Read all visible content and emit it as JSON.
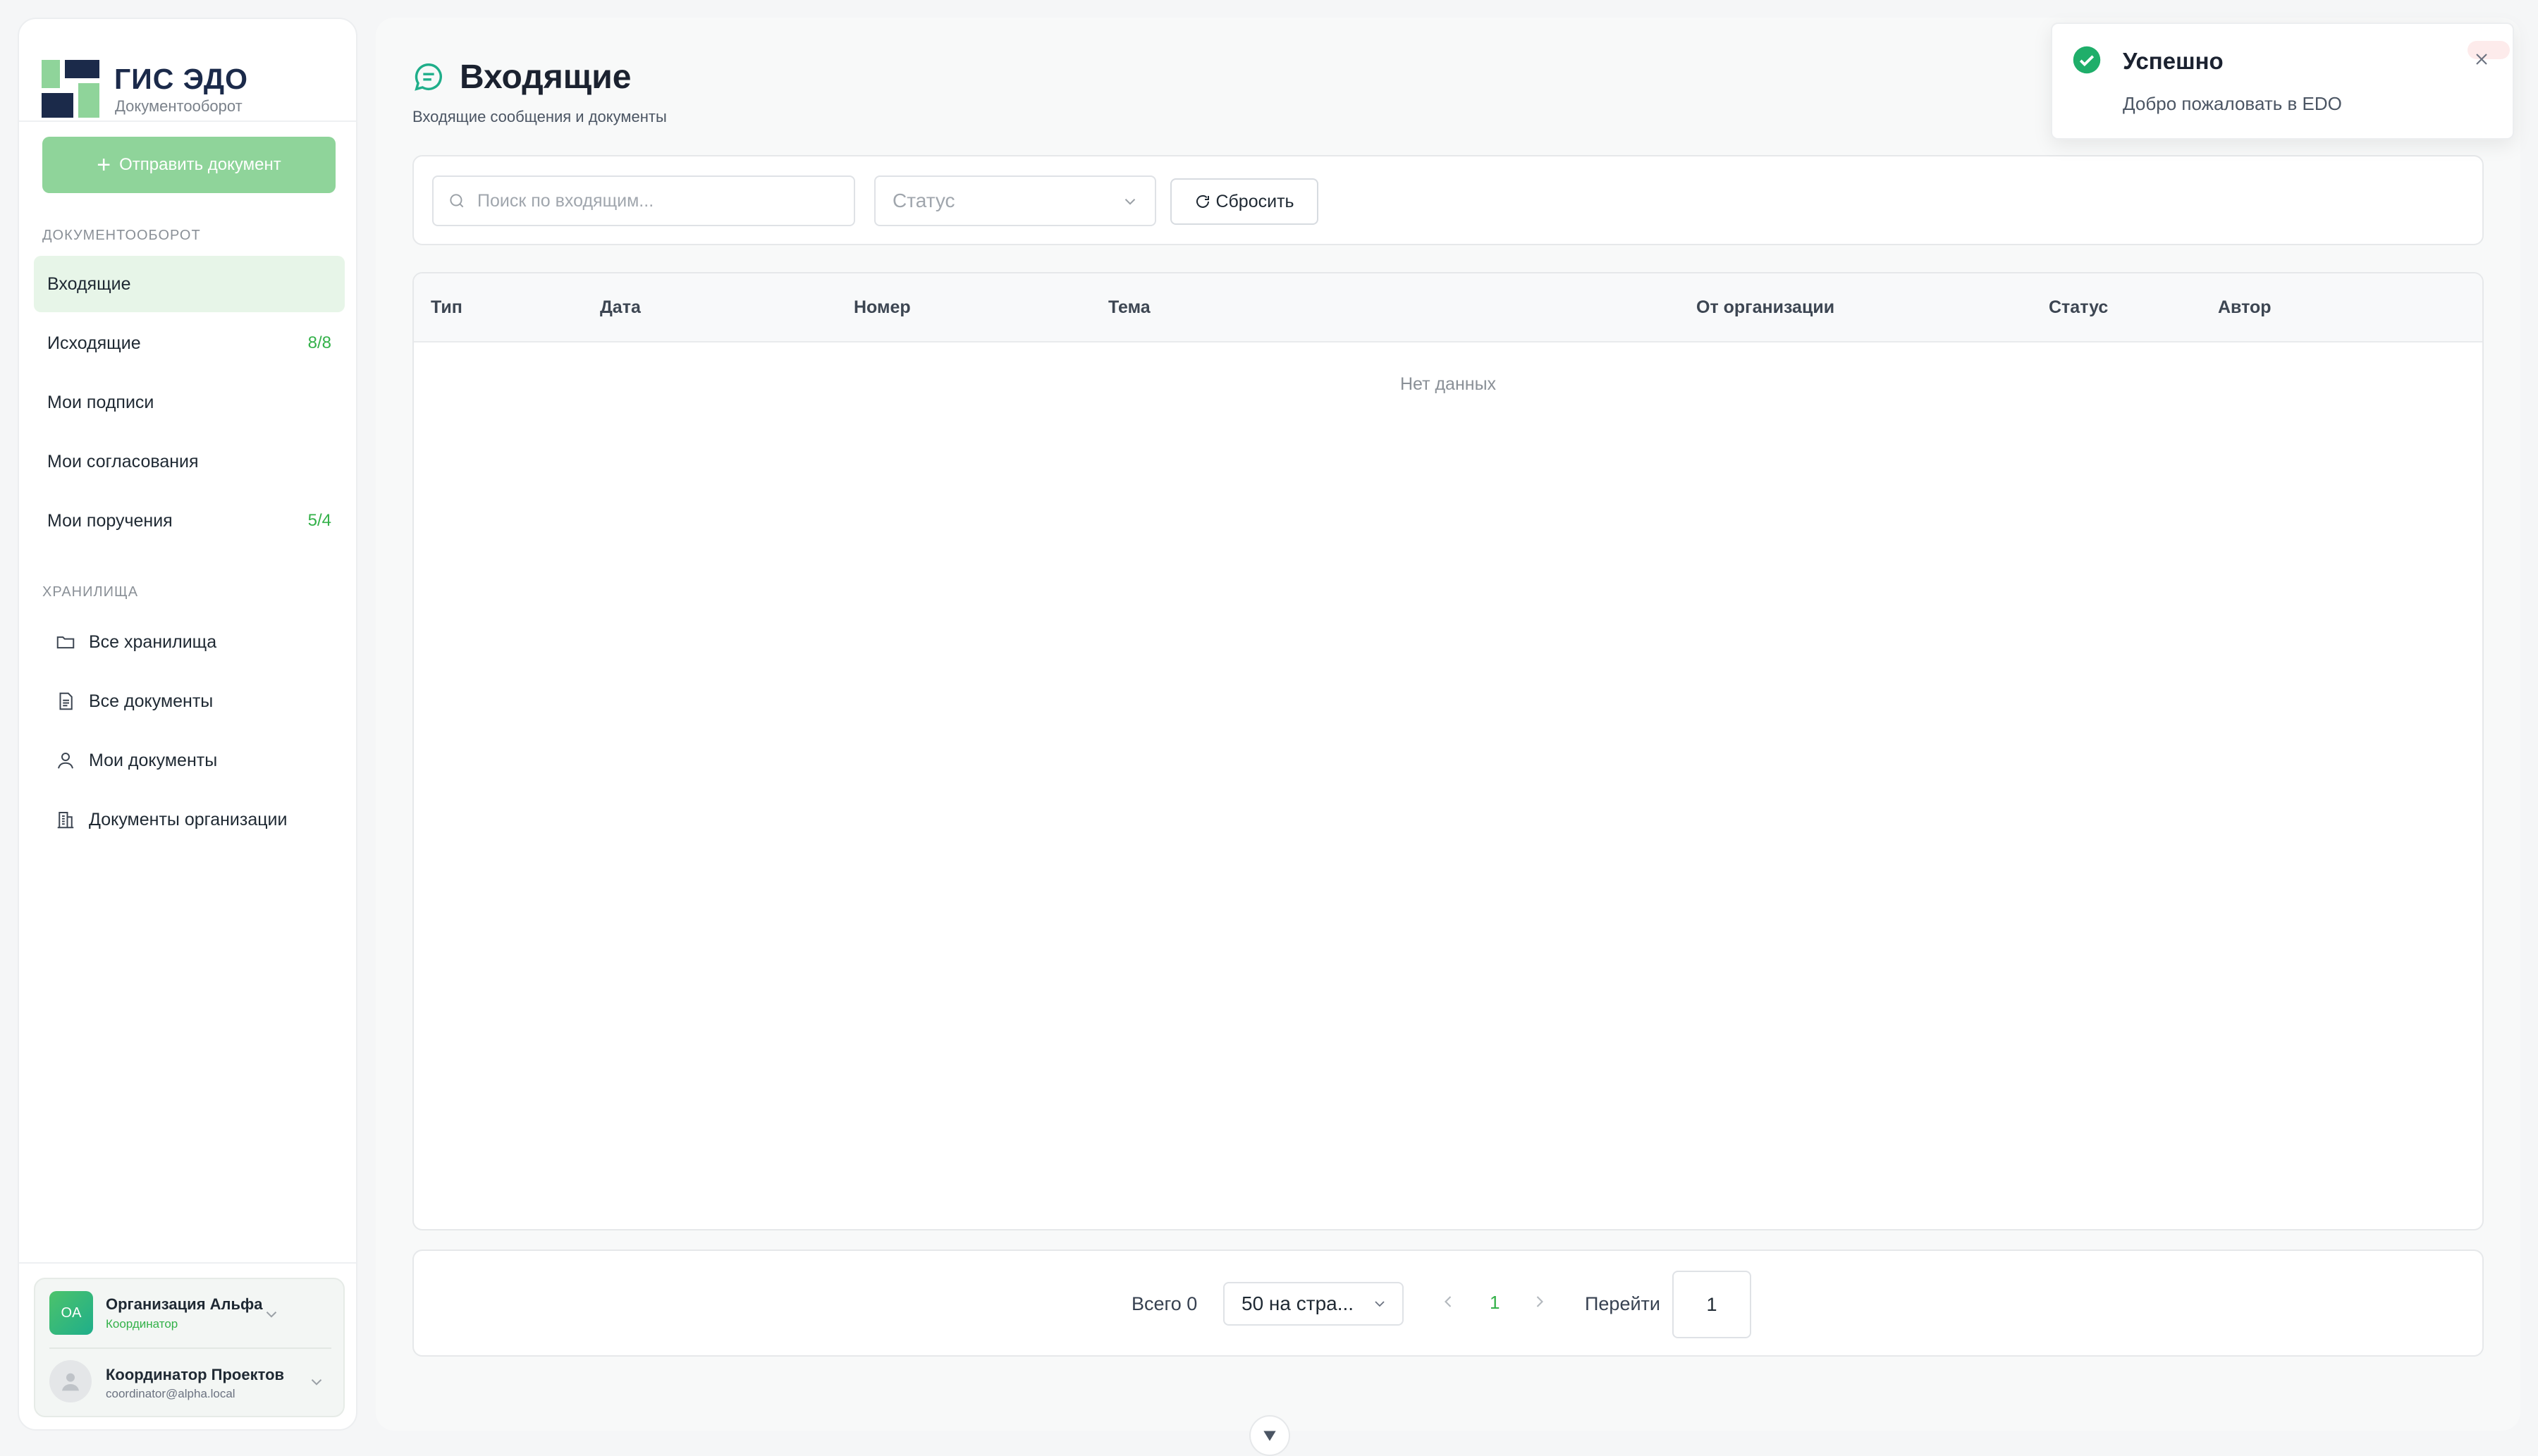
{
  "app": {
    "title": "ГИС ЭДО",
    "subtitle": "Документооборот",
    "brand_colors": {
      "accent": "#33b149",
      "navy": "#1b2a4a",
      "light_green": "#8fd49a"
    }
  },
  "sidebar": {
    "send_button": "Отправить документ",
    "section_docs": "ДОКУМЕНТООБОРОТ",
    "nav": [
      {
        "label": "Входящие",
        "count": "",
        "active": true
      },
      {
        "label": "Исходящие",
        "count": "8/8",
        "active": false
      },
      {
        "label": "Мои подписи",
        "count": "",
        "active": false
      },
      {
        "label": "Мои согласования",
        "count": "",
        "active": false
      },
      {
        "label": "Мои поручения",
        "count": "5/4",
        "active": false
      }
    ],
    "section_storage": "ХРАНИЛИЩА",
    "storage": [
      {
        "label": "Все хранилища",
        "icon": "folder-icon"
      },
      {
        "label": "Все документы",
        "icon": "document-icon"
      },
      {
        "label": "Мои документы",
        "icon": "user-icon"
      },
      {
        "label": "Документы организации",
        "icon": "building-icon"
      }
    ],
    "org": {
      "initials": "OA",
      "name": "Организация Альфа",
      "role": "Координатор"
    },
    "user": {
      "name": "Координатор Проектов",
      "email": "coordinator@alpha.local"
    }
  },
  "page": {
    "title": "Входящие",
    "subtitle": "Входящие сообщения и документы"
  },
  "filters": {
    "search_placeholder": "Поиск по входящим...",
    "status_placeholder": "Статус",
    "reset_label": "Сбросить"
  },
  "table": {
    "columns": [
      "Тип",
      "Дата",
      "Номер",
      "Тема",
      "От организации",
      "Статус",
      "Автор"
    ],
    "empty_text": "Нет данных"
  },
  "pagination": {
    "total": "Всего 0",
    "per_page": "50 на стра...",
    "current_page": "1",
    "goto_label": "Перейти",
    "goto_value": "1"
  },
  "toast": {
    "title": "Успешно",
    "message": "Добро пожаловать в EDO"
  }
}
